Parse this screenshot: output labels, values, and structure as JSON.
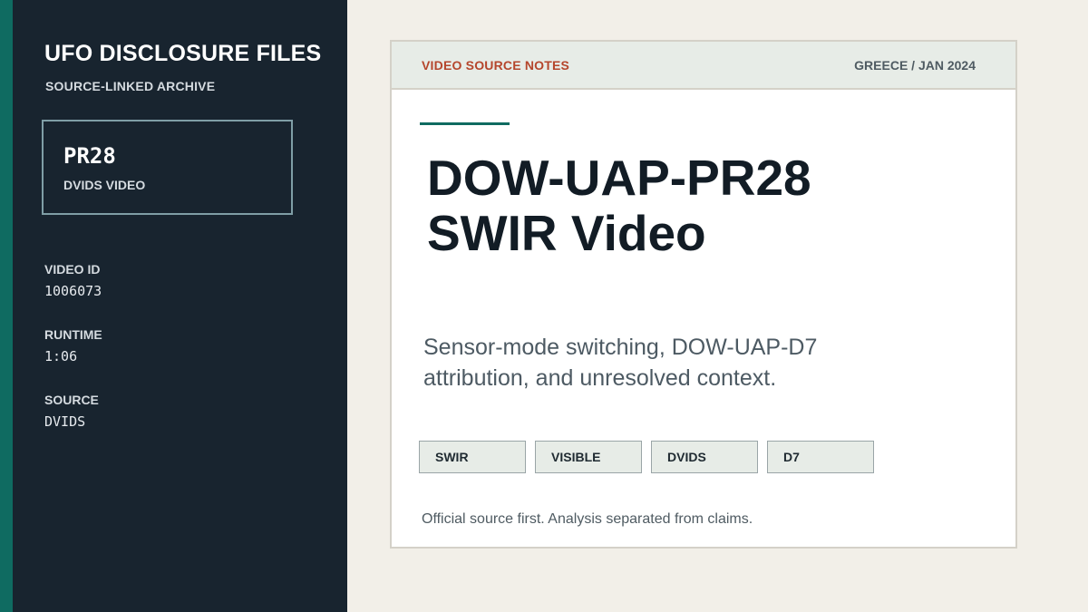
{
  "sidebar": {
    "title": "UFO DISCLOSURE FILES",
    "subtitle": "SOURCE-LINKED ARCHIVE",
    "card": {
      "code": "PR28",
      "type": "DVIDS VIDEO"
    },
    "meta": [
      {
        "label": "VIDEO ID",
        "value": "1006073"
      },
      {
        "label": "RUNTIME",
        "value": "1:06"
      },
      {
        "label": "SOURCE",
        "value": "DVIDS"
      }
    ]
  },
  "card": {
    "header_left": "VIDEO SOURCE NOTES",
    "header_right": "GREECE / JAN 2024",
    "headline": [
      "DOW-UAP-PR28",
      "SWIR Video"
    ],
    "summary": [
      "Sensor-mode switching, DOW-UAP-D7",
      "attribution, and unresolved context."
    ],
    "tags": [
      "SWIR",
      "VISIBLE",
      "DVIDS",
      "D7"
    ],
    "footer": "Official source first. Analysis separated from claims."
  },
  "colors": {
    "sidebar_bg": "#18242f",
    "accent_teal": "#0f6b61",
    "header_accent": "#b5462c",
    "page_bg": "#f2efe8"
  }
}
